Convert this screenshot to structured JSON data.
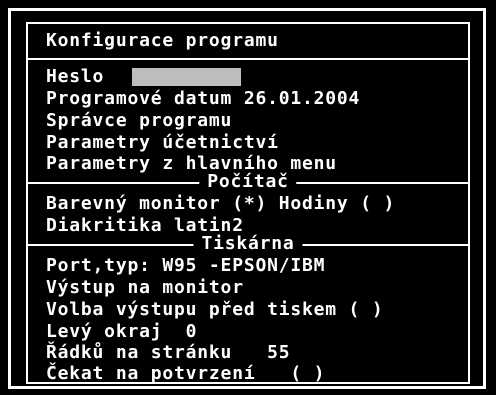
{
  "window": {
    "title": "Konfigurace programu"
  },
  "main": {
    "password_label": "Heslo",
    "password_value": "",
    "program_date": "Programové datum 26.01.2004",
    "admin": "Správce programu",
    "accounting_params": "Parametry účetnictví",
    "main_menu_params": "Parametry z hlavního menu"
  },
  "computer": {
    "title": "Počítač",
    "color_monitor": "Barevný monitor (*) Hodiny ( )",
    "diacritics": "Diakritika latin2"
  },
  "printer": {
    "title": "Tiskárna",
    "port_type": "Port,typ: W95 -EPSON/IBM",
    "output_monitor": "Výstup na monitor",
    "output_choice": "Volba výstupu před tiskem ( )",
    "left_margin": "Levý okraj  0",
    "lines_per_page": "Řádků na stránku   55",
    "confirm_wait": "Čekat na potvrzení   ( )"
  }
}
